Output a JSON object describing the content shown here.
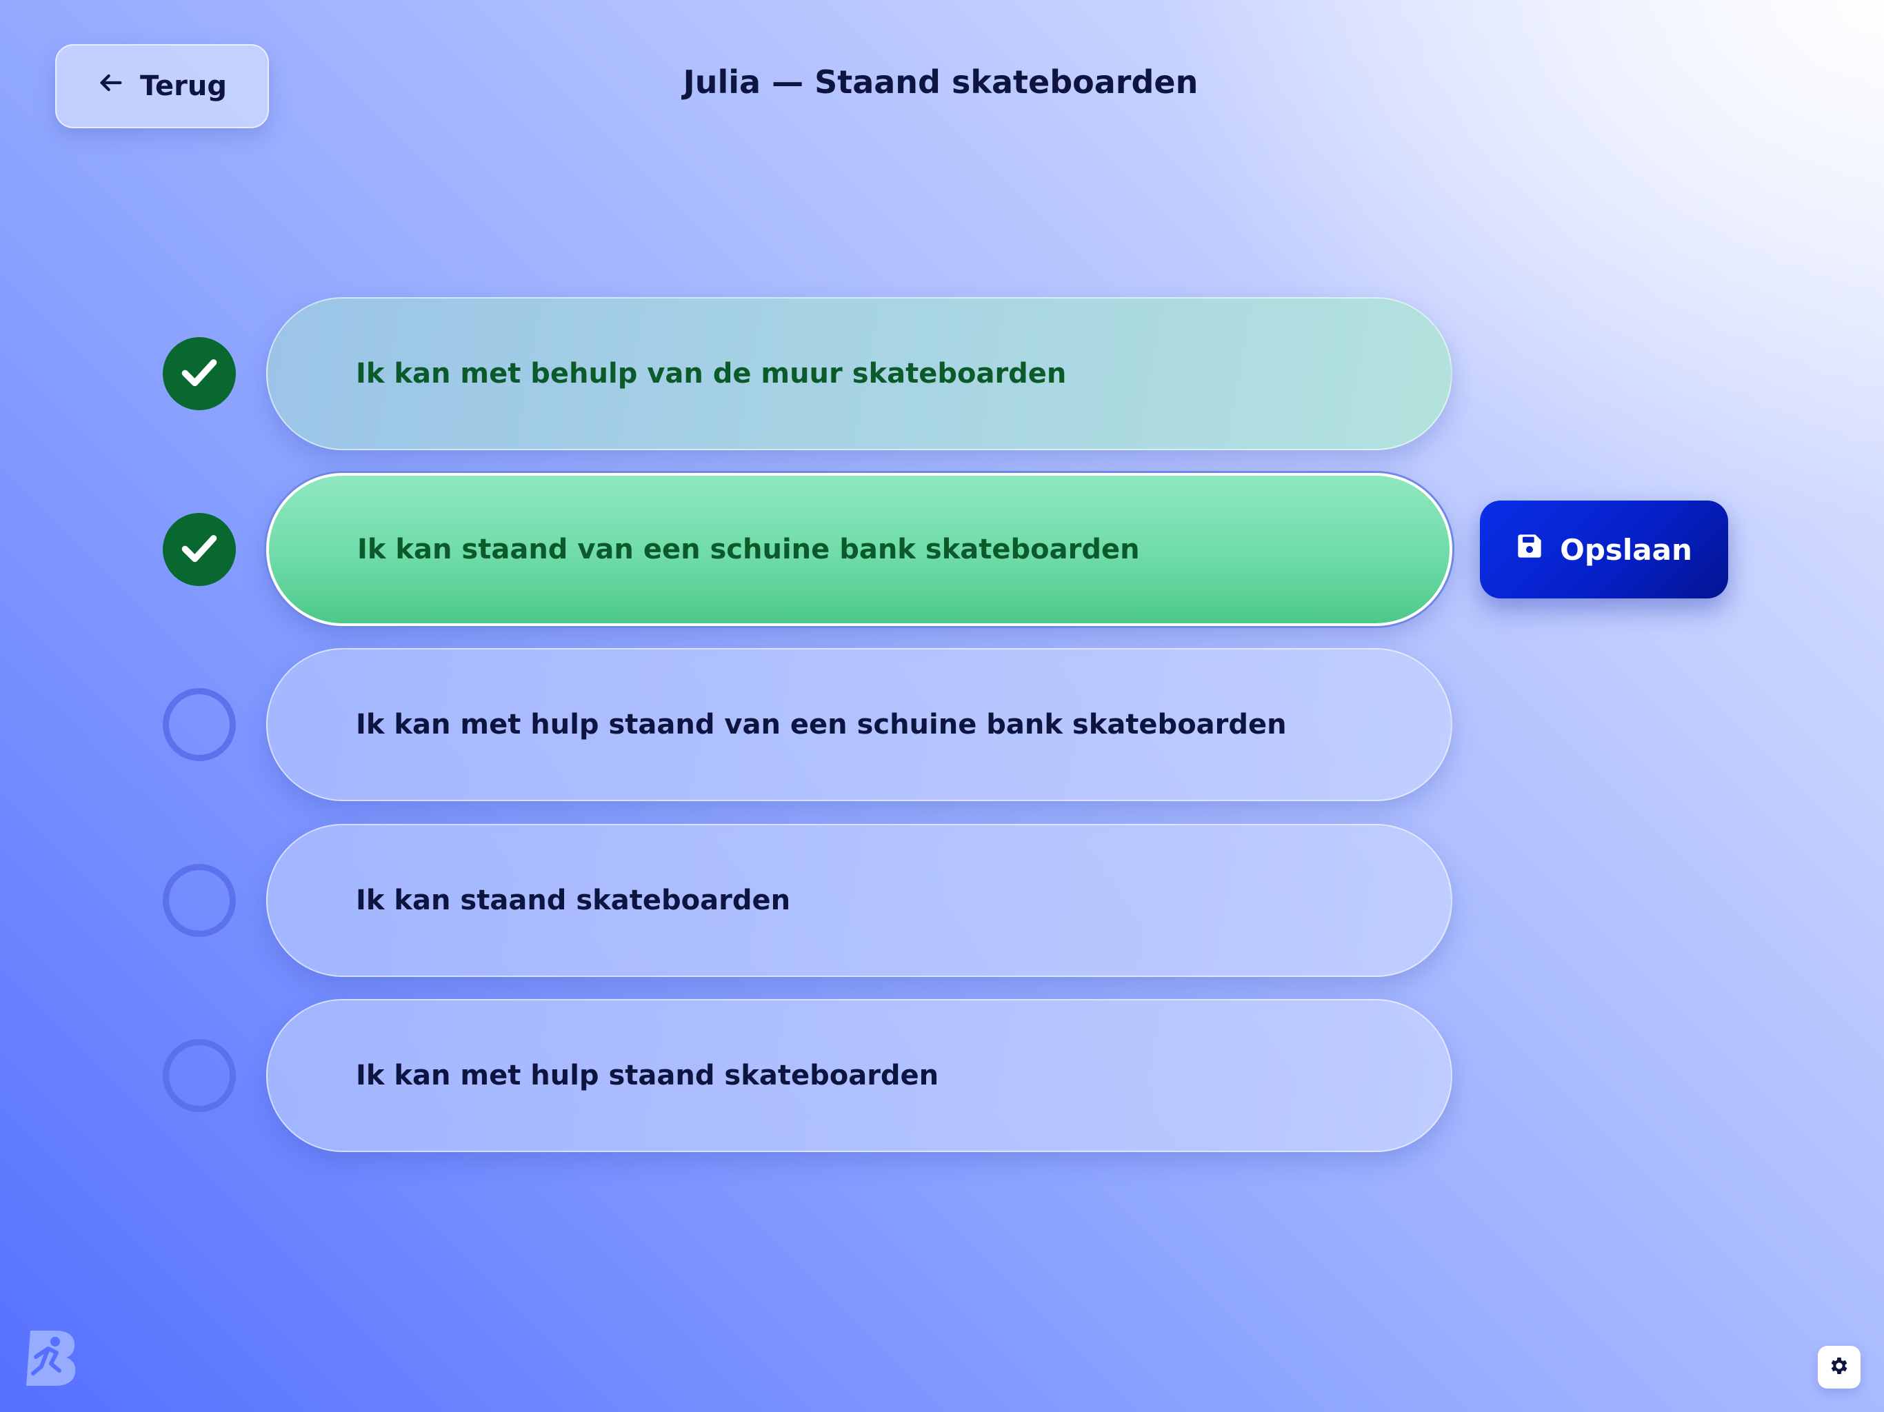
{
  "header": {
    "back_label": "Terug",
    "title": "Julia — Staand skateboarden"
  },
  "steps": [
    {
      "label": "Ik kan met behulp van de muur skateboarden",
      "status": "done"
    },
    {
      "label": "Ik kan staand van een schuine bank skateboarden",
      "status": "done",
      "selected": true
    },
    {
      "label": "Ik kan met hulp staand van een schuine bank skateboarden",
      "status": "open"
    },
    {
      "label": "Ik kan staand skateboarden",
      "status": "open"
    },
    {
      "label": "Ik kan met hulp staand skateboarden",
      "status": "open"
    }
  ],
  "actions": {
    "save_label": "Opslaan"
  },
  "icons": {
    "back": "arrow-left-icon",
    "check": "checkmark-icon",
    "save": "floppy-disk-icon",
    "settings": "gear-icon",
    "logo": "app-logo-icon"
  },
  "colors": {
    "done": "#08682f",
    "selected": "#6fdba8",
    "save": "#0620c8",
    "text": "#0d1440"
  }
}
